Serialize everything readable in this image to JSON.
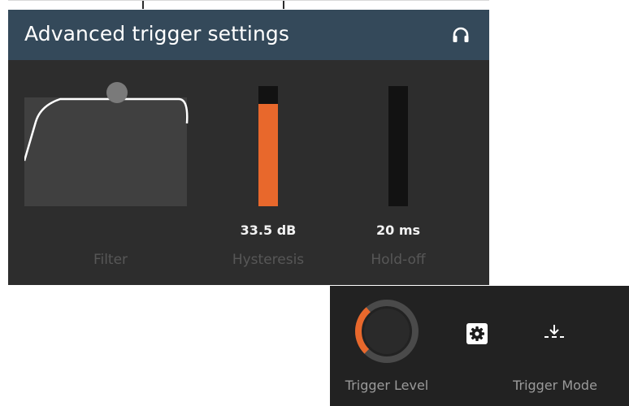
{
  "panel": {
    "title": "Advanced trigger settings",
    "header_icon": "headphone-icon",
    "colors": {
      "header": "#34495a",
      "body": "#2d2d2d",
      "accent": "#e8682c"
    }
  },
  "filter": {
    "caption": "Filter"
  },
  "hysteresis": {
    "value": "33.5 dB",
    "caption": "Hysteresis",
    "level": 0.85
  },
  "holdoff": {
    "value": "20 ms",
    "caption": "Hold-off",
    "level": 0
  },
  "trigger": {
    "level_caption": "Trigger Level",
    "mode_caption": "Trigger Mode",
    "settings_icon": "gear-icon",
    "mode_icon": "trigger-mode-icon",
    "knob_level": 0.35
  }
}
